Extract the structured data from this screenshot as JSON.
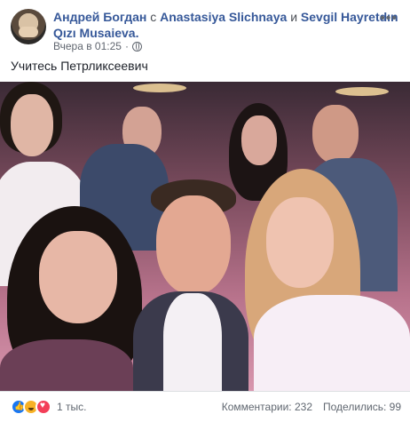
{
  "post": {
    "author": "Андрей Богдан",
    "with_word": "с",
    "tagged_1": "Anastasiya Slichnaya",
    "and_word": "и",
    "tagged_2": "Sevgil Hayretdın Qızı Musaieva.",
    "timestamp": "Вчера в 01:25",
    "separator": "·",
    "privacy_icon": "globe-icon",
    "text": "Учитесь Петрликсеевич"
  },
  "reactions": {
    "icons": [
      "like-icon",
      "haha-icon",
      "love-icon"
    ],
    "count": "1 тыс.",
    "comments": "Комментарии: 232",
    "shares": "Поделились: 99"
  },
  "colors": {
    "link": "#365899",
    "secondary": "#616770",
    "like": "#1877f2",
    "haha": "#f7b125",
    "love": "#f33e58"
  }
}
